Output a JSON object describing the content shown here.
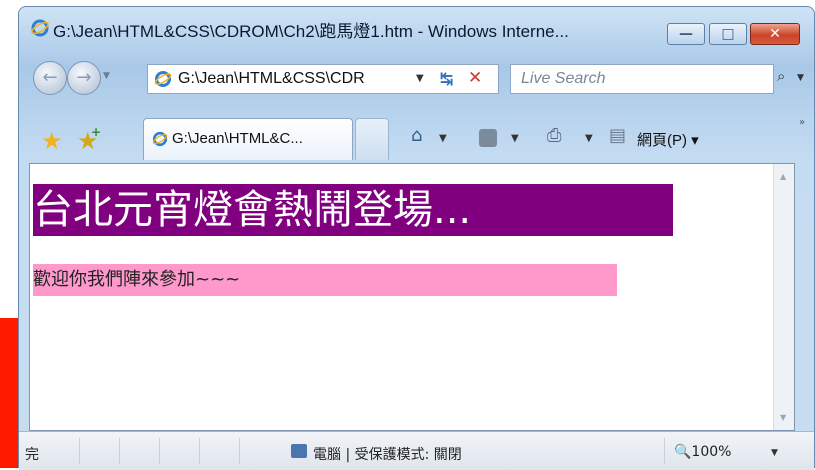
{
  "window": {
    "title": "G:\\Jean\\HTML&CSS\\CDROM\\Ch2\\跑馬燈1.htm - Windows Interne...",
    "minimize_glyph": "—",
    "maximize_glyph": "□",
    "close_glyph": "✕"
  },
  "navigation": {
    "back_glyph": "←",
    "forward_glyph": "→",
    "address": "G:\\Jean\\HTML&CSS\\CDR",
    "search_placeholder": "Live Search"
  },
  "tabs": [
    {
      "label": "G:\\Jean\\HTML&C..."
    }
  ],
  "command_bar": {
    "page_menu": "網頁(P) ▾"
  },
  "content": {
    "heading": "台北元宵燈會熱鬧登場...",
    "paragraph": "歡迎你我們陣來參加~~~"
  },
  "status_bar": {
    "status": "完",
    "zone": "電腦 | 受保護模式: 關閉",
    "zoom": "🔍100%"
  },
  "colors": {
    "heading_bg": "#800080",
    "heading_fg": "#ffffff",
    "paragraph_bg": "#ff99cc",
    "slide_accent": "#ff1a00"
  }
}
